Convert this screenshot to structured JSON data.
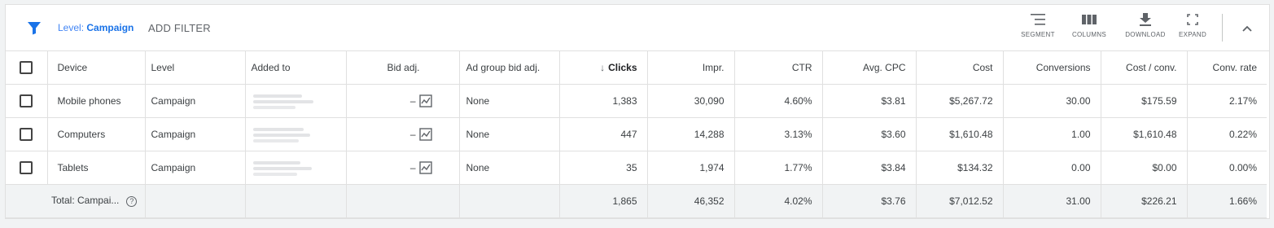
{
  "toolbar": {
    "level_prefix": "Level: ",
    "level_value": "Campaign",
    "add_filter": "ADD FILTER",
    "segment": "SEGMENT",
    "columns": "COLUMNS",
    "download": "DOWNLOAD",
    "expand": "EXPAND",
    "icons": {
      "filter": "filter-icon",
      "segment": "segment-icon",
      "columns": "columns-icon",
      "download": "download-icon",
      "expand": "expand-icon",
      "collapse": "chevron-up-icon"
    },
    "accent_color": "#1a73e8"
  },
  "headers": {
    "device": "Device",
    "level": "Level",
    "added_to": "Added to",
    "bid_adj": "Bid adj.",
    "ad_group_bid_adj": "Ad group bid adj.",
    "clicks": "Clicks",
    "impr": "Impr.",
    "ctr": "CTR",
    "avg_cpc": "Avg. CPC",
    "cost": "Cost",
    "conversions": "Conversions",
    "cost_conv": "Cost / conv.",
    "conv_rate": "Conv. rate"
  },
  "rows": [
    {
      "device": "Mobile phones",
      "level": "Campaign",
      "bid_adj": "–",
      "ad_group_bid_adj": "None",
      "clicks": "1,383",
      "impr": "30,090",
      "ctr": "4.60%",
      "avg_cpc": "$3.81",
      "cost": "$5,267.72",
      "conversions": "30.00",
      "cost_conv": "$175.59",
      "conv_rate": "2.17%"
    },
    {
      "device": "Computers",
      "level": "Campaign",
      "bid_adj": "–",
      "ad_group_bid_adj": "None",
      "clicks": "447",
      "impr": "14,288",
      "ctr": "3.13%",
      "avg_cpc": "$3.60",
      "cost": "$1,610.48",
      "conversions": "1.00",
      "cost_conv": "$1,610.48",
      "conv_rate": "0.22%"
    },
    {
      "device": "Tablets",
      "level": "Campaign",
      "bid_adj": "–",
      "ad_group_bid_adj": "None",
      "clicks": "35",
      "impr": "1,974",
      "ctr": "1.77%",
      "avg_cpc": "$3.84",
      "cost": "$134.32",
      "conversions": "0.00",
      "cost_conv": "$0.00",
      "conv_rate": "0.00%"
    }
  ],
  "total": {
    "label": "Total: Campai...",
    "clicks": "1,865",
    "impr": "46,352",
    "ctr": "4.02%",
    "avg_cpc": "$3.76",
    "cost": "$7,012.52",
    "conversions": "31.00",
    "cost_conv": "$226.21",
    "conv_rate": "1.66%"
  }
}
